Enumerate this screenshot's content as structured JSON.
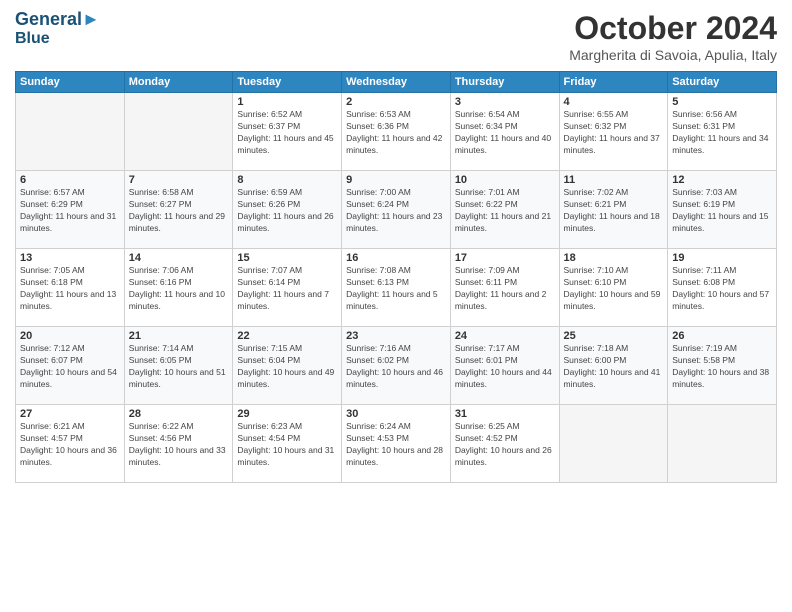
{
  "header": {
    "logo_line1": "General",
    "logo_line2": "Blue",
    "month": "October 2024",
    "location": "Margherita di Savoia, Apulia, Italy"
  },
  "weekdays": [
    "Sunday",
    "Monday",
    "Tuesday",
    "Wednesday",
    "Thursday",
    "Friday",
    "Saturday"
  ],
  "weeks": [
    [
      {
        "day": "",
        "info": ""
      },
      {
        "day": "",
        "info": ""
      },
      {
        "day": "1",
        "info": "Sunrise: 6:52 AM\nSunset: 6:37 PM\nDaylight: 11 hours and 45 minutes."
      },
      {
        "day": "2",
        "info": "Sunrise: 6:53 AM\nSunset: 6:36 PM\nDaylight: 11 hours and 42 minutes."
      },
      {
        "day": "3",
        "info": "Sunrise: 6:54 AM\nSunset: 6:34 PM\nDaylight: 11 hours and 40 minutes."
      },
      {
        "day": "4",
        "info": "Sunrise: 6:55 AM\nSunset: 6:32 PM\nDaylight: 11 hours and 37 minutes."
      },
      {
        "day": "5",
        "info": "Sunrise: 6:56 AM\nSunset: 6:31 PM\nDaylight: 11 hours and 34 minutes."
      }
    ],
    [
      {
        "day": "6",
        "info": "Sunrise: 6:57 AM\nSunset: 6:29 PM\nDaylight: 11 hours and 31 minutes."
      },
      {
        "day": "7",
        "info": "Sunrise: 6:58 AM\nSunset: 6:27 PM\nDaylight: 11 hours and 29 minutes."
      },
      {
        "day": "8",
        "info": "Sunrise: 6:59 AM\nSunset: 6:26 PM\nDaylight: 11 hours and 26 minutes."
      },
      {
        "day": "9",
        "info": "Sunrise: 7:00 AM\nSunset: 6:24 PM\nDaylight: 11 hours and 23 minutes."
      },
      {
        "day": "10",
        "info": "Sunrise: 7:01 AM\nSunset: 6:22 PM\nDaylight: 11 hours and 21 minutes."
      },
      {
        "day": "11",
        "info": "Sunrise: 7:02 AM\nSunset: 6:21 PM\nDaylight: 11 hours and 18 minutes."
      },
      {
        "day": "12",
        "info": "Sunrise: 7:03 AM\nSunset: 6:19 PM\nDaylight: 11 hours and 15 minutes."
      }
    ],
    [
      {
        "day": "13",
        "info": "Sunrise: 7:05 AM\nSunset: 6:18 PM\nDaylight: 11 hours and 13 minutes."
      },
      {
        "day": "14",
        "info": "Sunrise: 7:06 AM\nSunset: 6:16 PM\nDaylight: 11 hours and 10 minutes."
      },
      {
        "day": "15",
        "info": "Sunrise: 7:07 AM\nSunset: 6:14 PM\nDaylight: 11 hours and 7 minutes."
      },
      {
        "day": "16",
        "info": "Sunrise: 7:08 AM\nSunset: 6:13 PM\nDaylight: 11 hours and 5 minutes."
      },
      {
        "day": "17",
        "info": "Sunrise: 7:09 AM\nSunset: 6:11 PM\nDaylight: 11 hours and 2 minutes."
      },
      {
        "day": "18",
        "info": "Sunrise: 7:10 AM\nSunset: 6:10 PM\nDaylight: 10 hours and 59 minutes."
      },
      {
        "day": "19",
        "info": "Sunrise: 7:11 AM\nSunset: 6:08 PM\nDaylight: 10 hours and 57 minutes."
      }
    ],
    [
      {
        "day": "20",
        "info": "Sunrise: 7:12 AM\nSunset: 6:07 PM\nDaylight: 10 hours and 54 minutes."
      },
      {
        "day": "21",
        "info": "Sunrise: 7:14 AM\nSunset: 6:05 PM\nDaylight: 10 hours and 51 minutes."
      },
      {
        "day": "22",
        "info": "Sunrise: 7:15 AM\nSunset: 6:04 PM\nDaylight: 10 hours and 49 minutes."
      },
      {
        "day": "23",
        "info": "Sunrise: 7:16 AM\nSunset: 6:02 PM\nDaylight: 10 hours and 46 minutes."
      },
      {
        "day": "24",
        "info": "Sunrise: 7:17 AM\nSunset: 6:01 PM\nDaylight: 10 hours and 44 minutes."
      },
      {
        "day": "25",
        "info": "Sunrise: 7:18 AM\nSunset: 6:00 PM\nDaylight: 10 hours and 41 minutes."
      },
      {
        "day": "26",
        "info": "Sunrise: 7:19 AM\nSunset: 5:58 PM\nDaylight: 10 hours and 38 minutes."
      }
    ],
    [
      {
        "day": "27",
        "info": "Sunrise: 6:21 AM\nSunset: 4:57 PM\nDaylight: 10 hours and 36 minutes."
      },
      {
        "day": "28",
        "info": "Sunrise: 6:22 AM\nSunset: 4:56 PM\nDaylight: 10 hours and 33 minutes."
      },
      {
        "day": "29",
        "info": "Sunrise: 6:23 AM\nSunset: 4:54 PM\nDaylight: 10 hours and 31 minutes."
      },
      {
        "day": "30",
        "info": "Sunrise: 6:24 AM\nSunset: 4:53 PM\nDaylight: 10 hours and 28 minutes."
      },
      {
        "day": "31",
        "info": "Sunrise: 6:25 AM\nSunset: 4:52 PM\nDaylight: 10 hours and 26 minutes."
      },
      {
        "day": "",
        "info": ""
      },
      {
        "day": "",
        "info": ""
      }
    ]
  ]
}
